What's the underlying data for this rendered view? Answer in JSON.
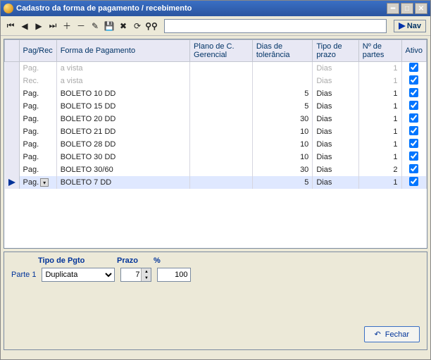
{
  "window": {
    "title": "Cadastro da forma de pagamento / recebimento"
  },
  "toolbar": {
    "nav_label": "Nav",
    "search_value": ""
  },
  "columns": {
    "pagrec": "Pag/Rec",
    "forma": "Forma de Pagamento",
    "plano": "Plano de C. Gerencial",
    "diastol": "Dias de tolerância",
    "tipoprazo": "Tipo de prazo",
    "npartes": "Nº de partes",
    "ativo": "Ativo"
  },
  "rows": [
    {
      "disabled": true,
      "pr": "Pag.",
      "forma": "a vista",
      "diastol": "",
      "tp": "Dias",
      "np": "1",
      "ativo": true
    },
    {
      "disabled": true,
      "pr": "Rec.",
      "forma": "a vista",
      "diastol": "",
      "tp": "Dias",
      "np": "1",
      "ativo": true
    },
    {
      "disabled": false,
      "pr": "Pag.",
      "forma": "BOLETO 10 DD",
      "diastol": "5",
      "tp": "Dias",
      "np": "1",
      "ativo": true
    },
    {
      "disabled": false,
      "pr": "Pag.",
      "forma": "BOLETO 15 DD",
      "diastol": "5",
      "tp": "Dias",
      "np": "1",
      "ativo": true
    },
    {
      "disabled": false,
      "pr": "Pag.",
      "forma": "BOLETO 20 DD",
      "diastol": "30",
      "tp": "Dias",
      "np": "1",
      "ativo": true
    },
    {
      "disabled": false,
      "pr": "Pag.",
      "forma": "BOLETO 21 DD",
      "diastol": "10",
      "tp": "Dias",
      "np": "1",
      "ativo": true
    },
    {
      "disabled": false,
      "pr": "Pag.",
      "forma": "BOLETO 28 DD",
      "diastol": "10",
      "tp": "Dias",
      "np": "1",
      "ativo": true
    },
    {
      "disabled": false,
      "pr": "Pag.",
      "forma": "BOLETO 30 DD",
      "diastol": "10",
      "tp": "Dias",
      "np": "1",
      "ativo": true
    },
    {
      "disabled": false,
      "pr": "Pag.",
      "forma": "BOLETO 30/60",
      "diastol": "30",
      "tp": "Dias",
      "np": "2",
      "ativo": true
    },
    {
      "disabled": false,
      "pr": "Pag.",
      "forma": "BOLETO 7 DD",
      "diastol": "5",
      "tp": "Dias",
      "np": "1",
      "ativo": true,
      "current": true
    }
  ],
  "panel": {
    "hdr_tipo": "Tipo de Pgto",
    "hdr_prazo": "Prazo",
    "hdr_pct": "%",
    "parte_label": "Parte 1",
    "tipo_value": "Duplicata",
    "prazo_value": "7",
    "pct_value": "100",
    "close_label": "Fechar"
  }
}
